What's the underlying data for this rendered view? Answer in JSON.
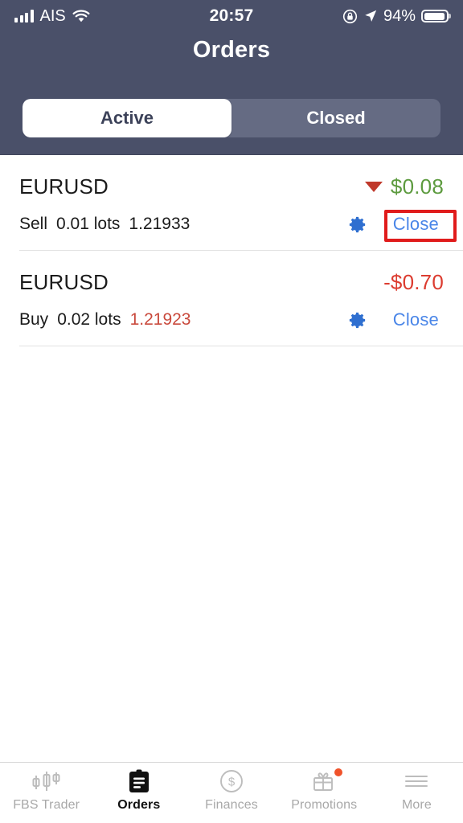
{
  "status_bar": {
    "carrier": "AIS",
    "time": "20:57",
    "battery_percent": "94%",
    "signal_icon": "cellular-bars-icon",
    "wifi_icon": "wifi-icon",
    "rotation_lock_icon": "rotation-lock-icon",
    "location_icon": "location-arrow-icon",
    "battery_icon": "battery-icon"
  },
  "header": {
    "title": "Orders",
    "background_color": "#4a5069",
    "segments": [
      {
        "label": "Active",
        "selected": true
      },
      {
        "label": "Closed",
        "selected": false
      }
    ]
  },
  "orders": [
    {
      "symbol": "EURUSD",
      "direction": "Sell",
      "volume": "0.01 lots",
      "price": "1.21933",
      "price_trend": "none",
      "profit": "$0.08",
      "profit_sign": "positive",
      "profit_color": "#5d9b3f",
      "trend_indicator_icon": "triangle-down-icon",
      "settings_icon": "gear-icon",
      "close_label": "Close",
      "highlighted": true
    },
    {
      "symbol": "EURUSD",
      "direction": "Buy",
      "volume": "0.02 lots",
      "price": "1.21923",
      "price_trend": "down",
      "profit": "-$0.70",
      "profit_sign": "negative",
      "profit_color": "#dc3c30",
      "trend_indicator_icon": "none",
      "settings_icon": "gear-icon",
      "close_label": "Close",
      "highlighted": false
    }
  ],
  "annotation": {
    "target": "Close",
    "color": "#e01b1b"
  },
  "tabbar": {
    "items": [
      {
        "label": "FBS Trader",
        "icon": "candlestick-chart-icon",
        "active": false,
        "badge": false
      },
      {
        "label": "Orders",
        "icon": "clipboard-icon",
        "active": true,
        "badge": false
      },
      {
        "label": "Finances",
        "icon": "dollar-circle-icon",
        "active": false,
        "badge": false
      },
      {
        "label": "Promotions",
        "icon": "gift-icon",
        "active": false,
        "badge": true
      },
      {
        "label": "More",
        "icon": "hamburger-menu-icon",
        "active": false,
        "badge": false
      }
    ]
  }
}
